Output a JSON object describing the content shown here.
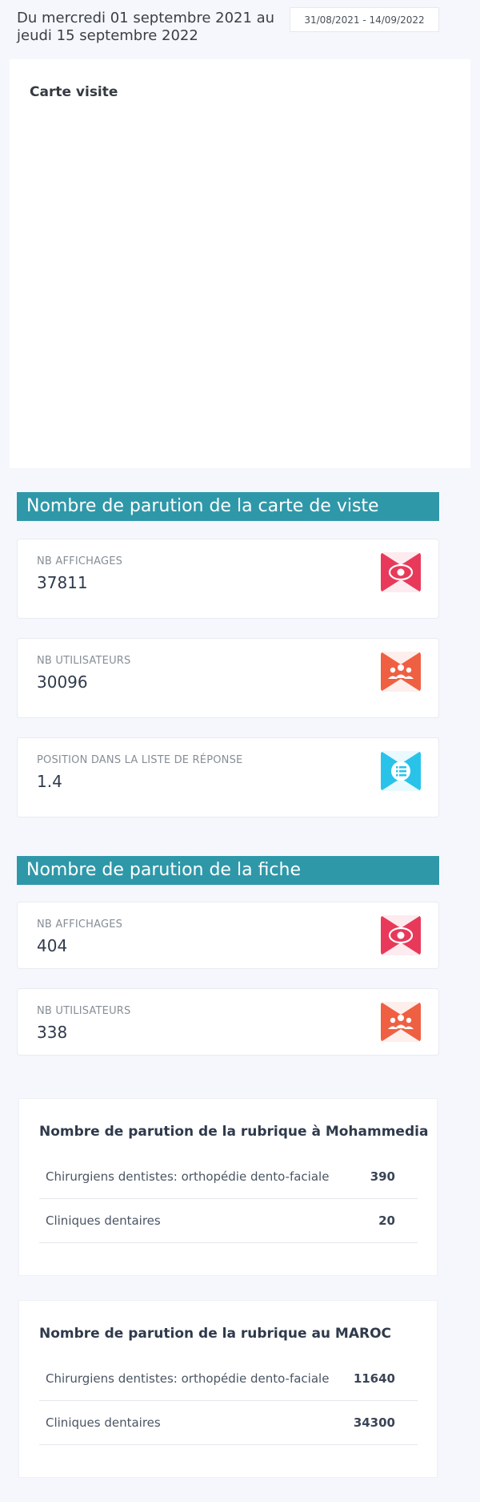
{
  "header": {
    "period_text": "Du mercredi 01 septembre 2021 au jeudi 15 septembre 2022",
    "date_range": "31/08/2021 - 14/09/2022"
  },
  "map_card": {
    "title": "Carte visite"
  },
  "section_card": {
    "title": "Nombre de parution de la carte de viste",
    "stats": [
      {
        "label": "NB AFFICHAGES",
        "value": "37811",
        "icon": "eye-icon",
        "color": "#e8395a"
      },
      {
        "label": "NB UTILISATEURS",
        "value": "30096",
        "icon": "users-icon",
        "color": "#ef5f42"
      },
      {
        "label": "POSITION DANS LA LISTE DE RÉPONSE",
        "value": "1.4",
        "icon": "list-icon",
        "color": "#29c3ea"
      }
    ]
  },
  "section_fiche": {
    "title": "Nombre de parution de la fiche",
    "stats": [
      {
        "label": "NB AFFICHAGES",
        "value": "404",
        "icon": "eye-icon",
        "color": "#e8395a"
      },
      {
        "label": "NB UTILISATEURS",
        "value": "338",
        "icon": "users-icon",
        "color": "#ef5f42"
      }
    ]
  },
  "rubrique_local": {
    "title": "Nombre de parution de la rubrique à Mohammedia",
    "rows": [
      {
        "name": "Chirurgiens dentistes: orthopédie dento-faciale",
        "value": "390"
      },
      {
        "name": "Cliniques dentaires",
        "value": "20"
      }
    ]
  },
  "rubrique_maroc": {
    "title": "Nombre de parution de la rubrique au MAROC",
    "rows": [
      {
        "name": "Chirurgiens dentistes: orthopédie dento-faciale",
        "value": "11640"
      },
      {
        "name": "Cliniques dentaires",
        "value": "34300"
      }
    ]
  }
}
